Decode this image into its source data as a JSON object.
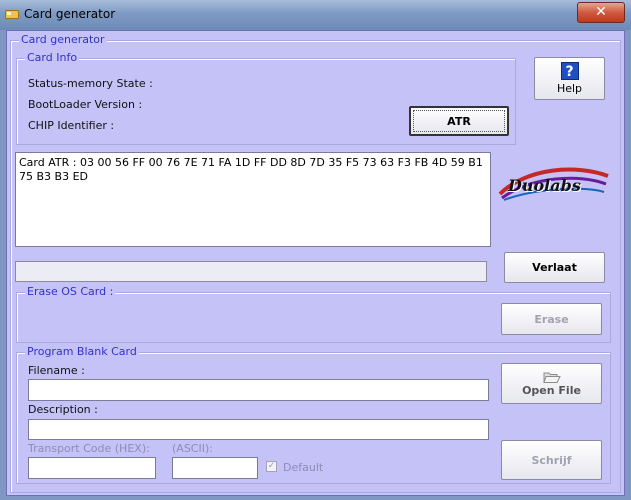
{
  "window": {
    "title": "Card generator",
    "close_label": "✕"
  },
  "main_group": {
    "label": "Card generator"
  },
  "card_info": {
    "label": "Card Info",
    "status_memory_label": "Status-memory State :",
    "bootloader_label": "BootLoader Version :",
    "chip_label": "CHIP Identifier :"
  },
  "buttons": {
    "atr": "ATR",
    "help": "Help",
    "help_icon": "?",
    "verlaat": "Verlaat",
    "erase": "Erase",
    "open_file": "Open File",
    "schrijf": "Schrijf"
  },
  "atr_output": "Card ATR : 03 00 56 FF 00 76 7E 71 FA 1D FF DD 8D 7D 35 F5 73 63 F3 FB 4D 59 B1 75 B3 B3 ED",
  "logo": {
    "text": "Duolabs"
  },
  "progress": 0,
  "erase_group": {
    "label": "Erase OS Card :"
  },
  "program_group": {
    "label": "Program Blank Card",
    "filename_label": "Filename :",
    "filename_value": "",
    "description_label": "Description :",
    "description_value": "",
    "transport_hex_label": "Transport Code (HEX):",
    "transport_ascii_label": "(ASCII):",
    "default_label": "Default",
    "default_checked": true
  },
  "icons": {
    "app": "card-icon",
    "help": "help-icon",
    "open": "folder-open-icon",
    "close": "close-icon"
  },
  "colors": {
    "client_bg": "#c4c2f7",
    "group_label": "#3232c8",
    "titlebar": "#7e9ac4",
    "close_button": "#c0391c"
  }
}
